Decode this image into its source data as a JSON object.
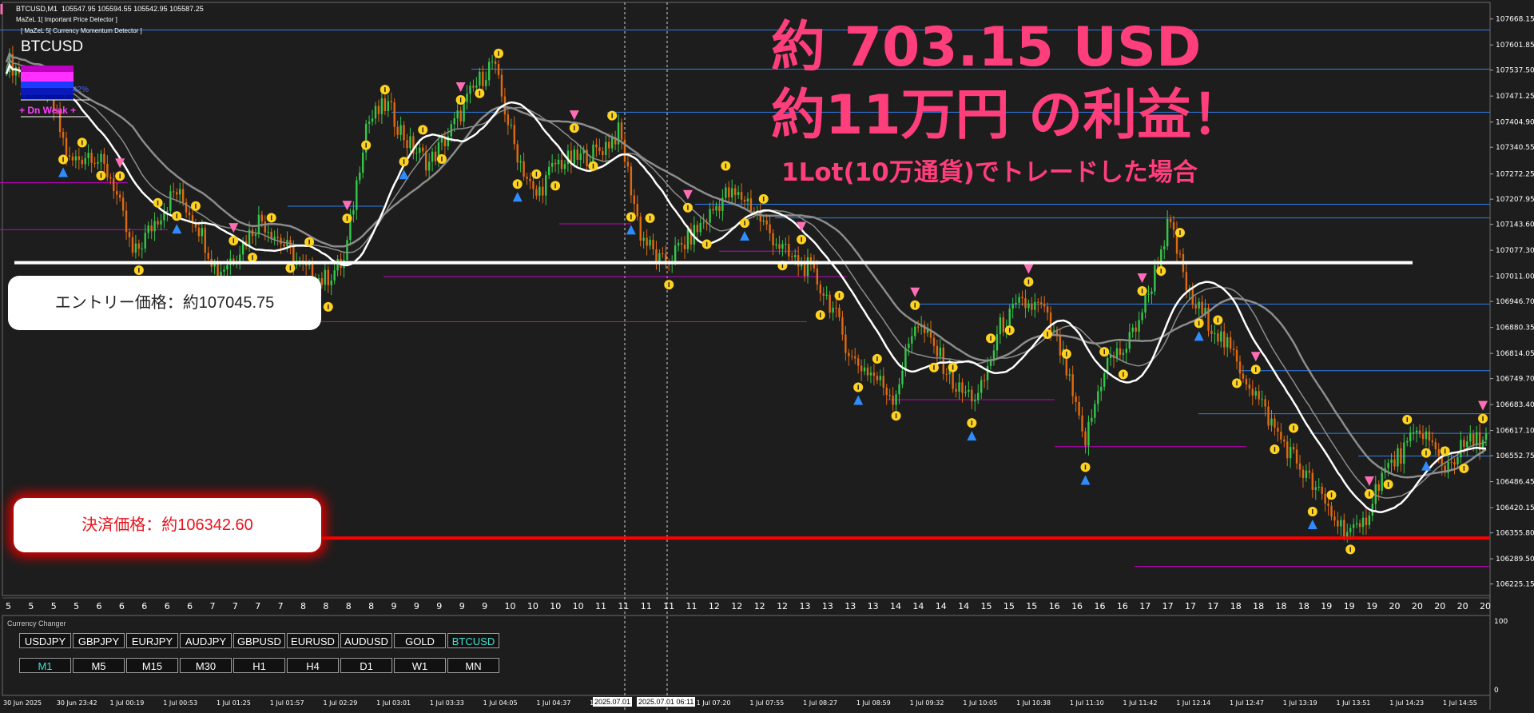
{
  "header": {
    "symbol_timeframe": "BTCUSD,M1",
    "ohlc": "105547.95 105594.55 105542.95 105587.25",
    "indicator1": "MaZeL 1[ Important Price Detector ]",
    "indicator2": "[ MaZeL 5[ Currency Momentum Detector ]",
    "symbol_big": "BTCUSD",
    "meter_percent": "42%",
    "strength": "+  Dn Weak  +"
  },
  "annotations": {
    "profit_usd": "約 703.15 USD",
    "profit_jpy": "約11万円 の利益！",
    "condition": "1Lot(10万通貨)でトレードした場合",
    "entry_label": "エントリー価格：約107045.75",
    "settle_label": "決済価格：約106342.60"
  },
  "price_axis": {
    "ticks": [
      "107668.15",
      "107601.85",
      "107537.50",
      "107471.25",
      "107404.90",
      "107340.55",
      "107272.25",
      "107207.95",
      "107143.60",
      "107077.30",
      "107011.00",
      "106946.70",
      "106880.35",
      "106814.05",
      "106749.70",
      "106683.40",
      "106617.10",
      "106552.75",
      "106486.45",
      "106420.15",
      "106355.80",
      "106289.50",
      "106225.15"
    ],
    "max": 107688,
    "min": 106206
  },
  "chart_data": {
    "type": "line",
    "title": "",
    "entry_price": 107045.75,
    "exit_price": 106342.6,
    "x_day_labels": [
      "5",
      "5",
      "5",
      "5",
      "6",
      "6",
      "6",
      "6",
      "6",
      "7",
      "7",
      "7",
      "7",
      "8",
      "8",
      "8",
      "8",
      "9",
      "9",
      "9",
      "9",
      "9",
      "10",
      "10",
      "10",
      "10",
      "11",
      "11",
      "11",
      "11",
      "11",
      "12",
      "12",
      "12",
      "12",
      "13",
      "13",
      "13",
      "13",
      "14",
      "14",
      "14",
      "14",
      "15",
      "15",
      "15",
      "16",
      "16",
      "16",
      "16",
      "17",
      "17",
      "17",
      "17",
      "18",
      "18",
      "18",
      "18",
      "19",
      "19",
      "19",
      "20",
      "20",
      "20",
      "20",
      "20"
    ],
    "close_series": [
      107560,
      107520,
      107480,
      107300,
      107330,
      107260,
      107060,
      107150,
      107230,
      107150,
      107020,
      107080,
      107160,
      107100,
      107030,
      107000,
      107050,
      107400,
      107450,
      107350,
      107300,
      107380,
      107480,
      107560,
      107350,
      107210,
      107300,
      107310,
      107330,
      107380,
      107120,
      107040,
      107090,
      107150,
      107220,
      107210,
      107130,
      107060,
      107030,
      106940,
      106800,
      106760,
      106700,
      106900,
      106820,
      106720,
      106700,
      106880,
      106940,
      106930,
      106800,
      106580,
      106790,
      106830,
      106960,
      107150,
      106950,
      106890,
      106810,
      106720,
      106620,
      106540,
      106460,
      106380,
      106350,
      106500,
      106560,
      106620,
      106520,
      106580,
      106600
    ]
  },
  "subwindow": {
    "title": "Currency Changer",
    "currencies": [
      "USDJPY",
      "GBPJPY",
      "EURJPY",
      "AUDJPY",
      "GBPUSD",
      "EURUSD",
      "AUDUSD",
      "GOLD",
      "BTCUSD"
    ],
    "active_currency": "BTCUSD",
    "timeframes": [
      "M1",
      "M5",
      "M15",
      "M30",
      "H1",
      "H4",
      "D1",
      "W1",
      "MN"
    ],
    "active_timeframe": "M1",
    "axis_top": "100",
    "axis_bottom": "0"
  },
  "time_axis": {
    "labels": [
      "30 Jun 2025",
      "30 Jun 23:42",
      "1 Jul 00:19",
      "1 Jul 00:53",
      "1 Jul 01:25",
      "1 Jul 01:57",
      "1 Jul 02:29",
      "1 Jul 03:01",
      "1 Jul 03:33",
      "1 Jul 04:05",
      "1 Jul 04:37",
      "1 Jul 05",
      "2025.07.01",
      "2025.07.01 06:11",
      "1 Jul 06:48",
      "1 Jul 07:20",
      "1 Jul 07:55",
      "1 Jul 08:27",
      "1 Jul 08:59",
      "1 Jul 09:32",
      "1 Jul 10:05",
      "1 Jul 10:38",
      "1 Jul 11:10",
      "1 Jul 11:42",
      "1 Jul 12:14",
      "1 Jul 12:47",
      "1 Jul 13:19",
      "1 Jul 13:51",
      "1 Jul 14:23",
      "1 Jul 14:55"
    ]
  },
  "colors": {
    "background": "#1d1d1d",
    "entry_line": "#ffffff",
    "exit_line": "#ff0000",
    "profit_text": "#ff3e7c",
    "blue_level": "#2f7ff0",
    "magenta_level": "#c800c8",
    "ma_gray": "#8c8c8c"
  }
}
